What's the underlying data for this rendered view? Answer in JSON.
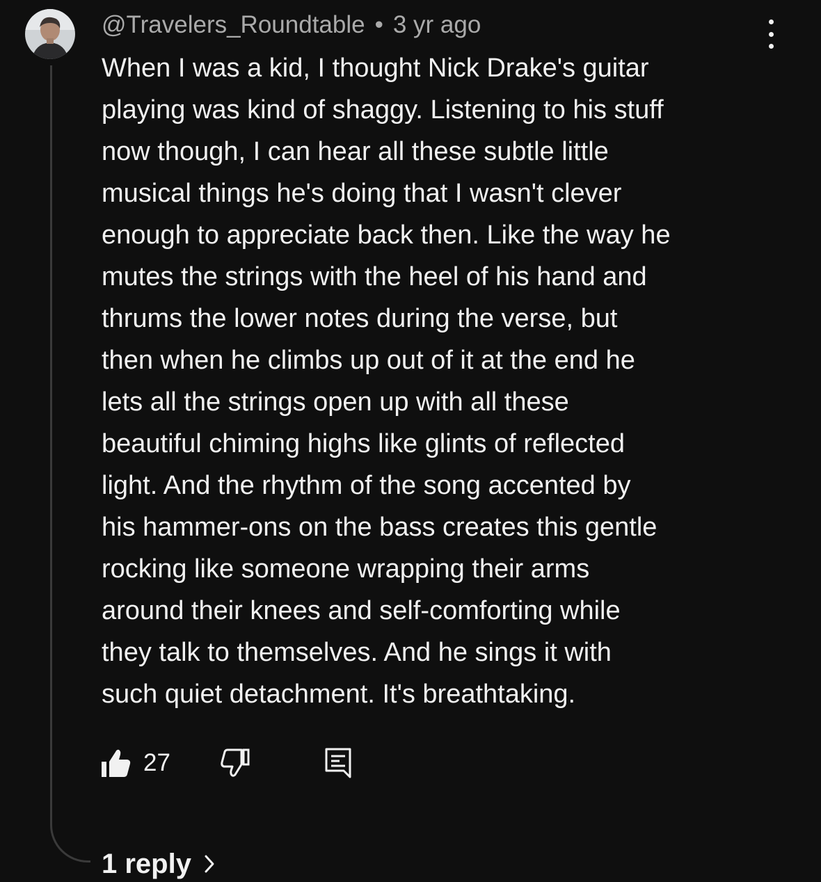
{
  "comment": {
    "author": "@Travelers_Roundtable",
    "separator": "•",
    "time_ago": "3 yr ago",
    "lines": [
      "When I was a kid, I thought Nick Drake's guitar",
      "playing was kind of shaggy. Listening to his stuff",
      "now though, I can hear all these subtle little",
      "musical things he's doing that I wasn't clever",
      "enough to appreciate back then. Like the way he",
      "mutes the strings with the heel of his hand and",
      "thrums the lower notes during the verse, but",
      "then when he climbs up out of it at the end he",
      "lets all the strings open up with all these",
      "beautiful chiming highs like glints of reflected",
      "light. And the rhythm of the song accented by",
      "his hammer-ons on the bass creates this gentle",
      "rocking like someone wrapping their arms",
      "around their knees and self-comforting while",
      "they talk to themselves. And he sings it with",
      "such quiet detachment. It's breathtaking."
    ],
    "like_count": "27",
    "replies_label": "1 reply"
  },
  "icons": {
    "more": "more-vert-icon",
    "like": "thumbs-up-filled-icon",
    "dislike": "thumbs-down-outline-icon",
    "reply": "reply-comment-icon",
    "chevron": "chevron-right-icon"
  },
  "colors": {
    "background": "#0f0f0f",
    "text": "#f1f1f1",
    "meta_text": "#aaaaaa",
    "thread_line": "#3a3a3a"
  }
}
